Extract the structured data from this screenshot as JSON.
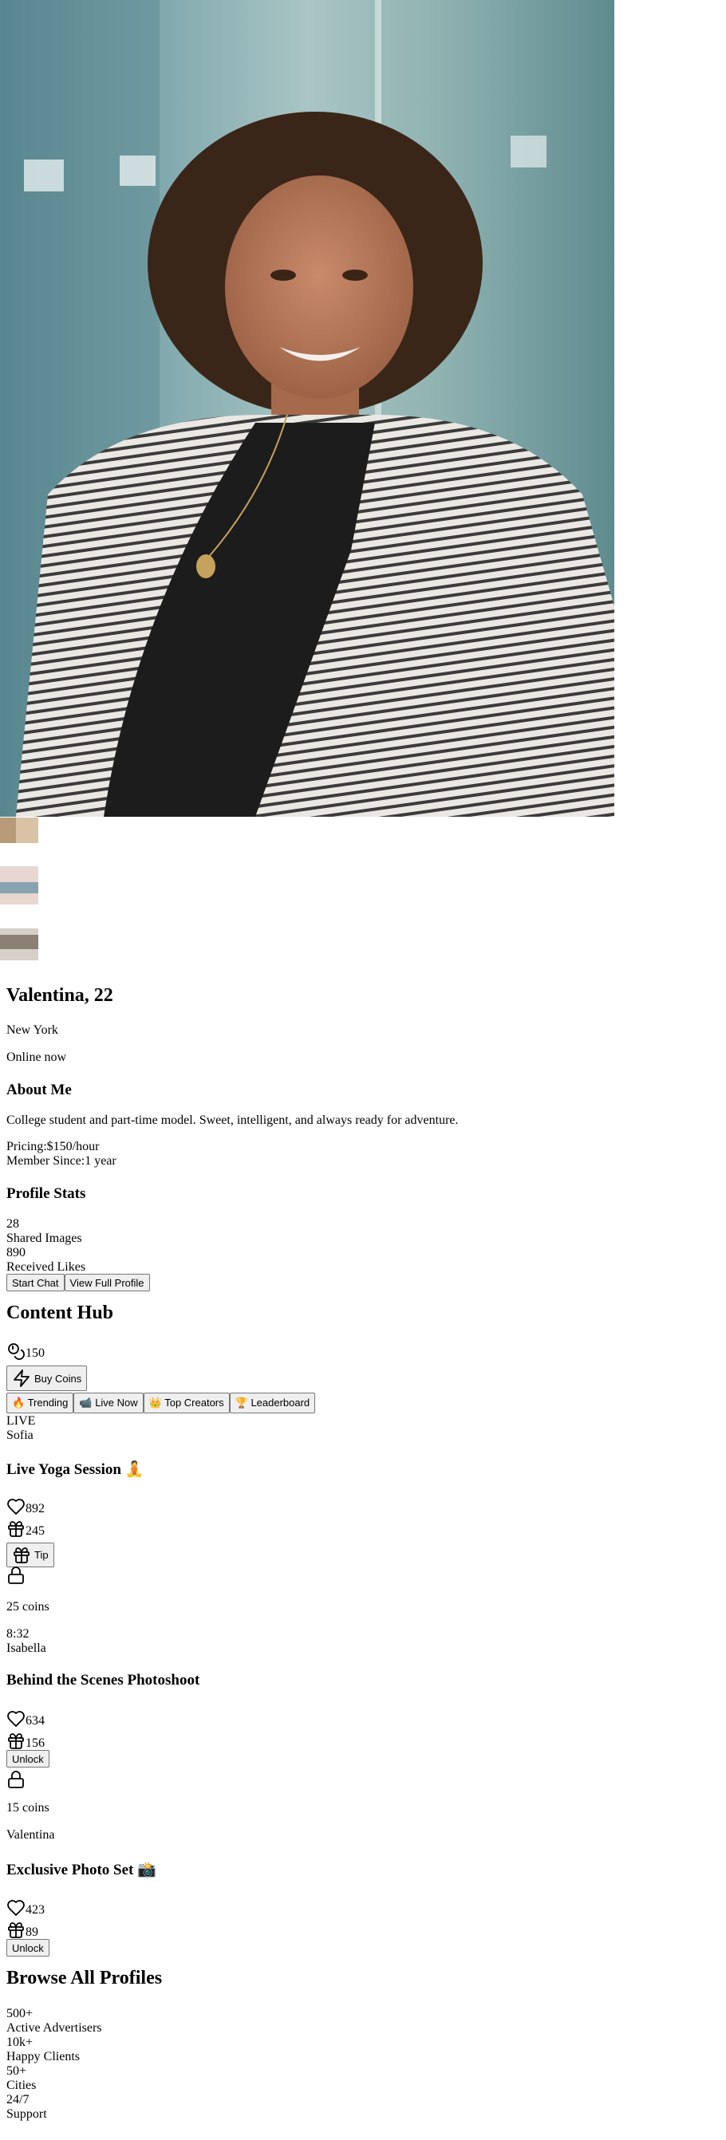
{
  "profile": {
    "name_age": "Valentina, 22",
    "location": "New York",
    "status": "Online now"
  },
  "about": {
    "heading": "About Me",
    "bio": "College student and part-time model. Sweet, intelligent, and always ready for adventure.",
    "pricing_label": "Pricing:",
    "pricing_value": "$150/hour",
    "member_label": "Member Since:",
    "member_value": "1 year"
  },
  "stats": {
    "heading": "Profile Stats",
    "shared_images_value": "28",
    "shared_images_label": "Shared Images",
    "received_likes_value": "890",
    "received_likes_label": "Received Likes"
  },
  "actions": {
    "start_chat": "Start Chat",
    "view_full_profile": "View Full Profile"
  },
  "hub": {
    "heading": "Content Hub",
    "coin_balance": "150",
    "buy_coins": "Buy Coins",
    "tabs": [
      "🔥 Trending",
      "📹 Live Now",
      "👑 Top Creators",
      "🏆 Leaderboard"
    ]
  },
  "posts": [
    {
      "badge": "LIVE",
      "creator": "Sofia",
      "title": "Live Yoga Session 🧘",
      "likes": "892",
      "gifts": "245",
      "tip_label": "Tip"
    },
    {
      "lock_price": "25 coins",
      "duration": "8:32",
      "creator": "Isabella",
      "title": "Behind the Scenes Photoshoot",
      "likes": "634",
      "gifts": "156",
      "unlock_label": "Unlock"
    },
    {
      "lock_price": "15 coins",
      "creator": "Valentina",
      "title": "Exclusive Photo Set 📸",
      "likes": "423",
      "gifts": "89",
      "unlock_label": "Unlock"
    }
  ],
  "browse": {
    "heading": "Browse All Profiles",
    "stats": [
      {
        "value": "500+",
        "label": "Active Advertisers"
      },
      {
        "value": "10k+",
        "label": "Happy Clients"
      },
      {
        "value": "50+",
        "label": "Cities"
      },
      {
        "value": "24/7",
        "label": "Support"
      }
    ]
  },
  "icons": {
    "coin": "coin-icon",
    "bolt": "lightning-icon",
    "heart": "heart-icon",
    "gift": "gift-icon",
    "lock": "lock-icon"
  },
  "colors": {
    "hero_background": "#7fa8ad",
    "jacket": "#e8e6e3",
    "top": "#1c1c1c"
  }
}
